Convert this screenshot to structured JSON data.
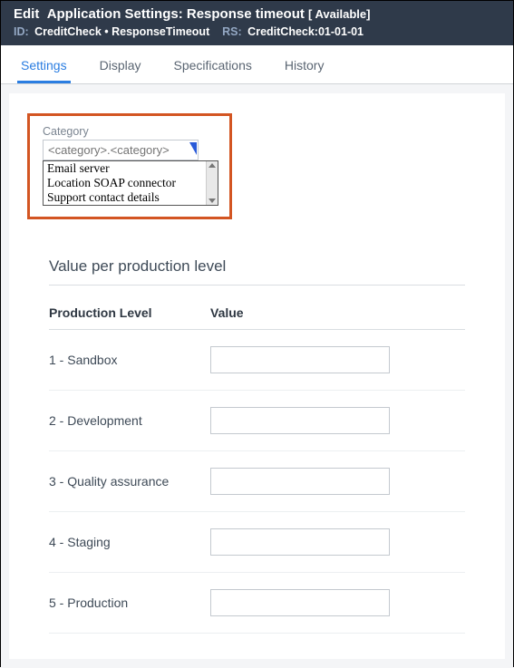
{
  "header": {
    "edit_label": "Edit",
    "title": "Application Settings: Response timeout",
    "availability": "[ Available]",
    "id_label": "ID:",
    "id_value": "CreditCheck • ResponseTimeout",
    "rs_label": "RS:",
    "rs_value": "CreditCheck:01-01-01"
  },
  "tabs": [
    {
      "label": "Settings",
      "active": true
    },
    {
      "label": "Display",
      "active": false
    },
    {
      "label": "Specifications",
      "active": false
    },
    {
      "label": "History",
      "active": false
    }
  ],
  "category": {
    "label": "Category",
    "placeholder": "<category>.<category>",
    "options": [
      "Email server",
      "Location SOAP connector",
      "Support contact details"
    ]
  },
  "section_title": "Value per production level",
  "table": {
    "col_level": "Production Level",
    "col_value": "Value",
    "rows": [
      {
        "level": "1 - Sandbox",
        "value": ""
      },
      {
        "level": "2 - Development",
        "value": ""
      },
      {
        "level": "3 - Quality assurance",
        "value": ""
      },
      {
        "level": "4 - Staging",
        "value": ""
      },
      {
        "level": "5 - Production",
        "value": ""
      }
    ]
  }
}
